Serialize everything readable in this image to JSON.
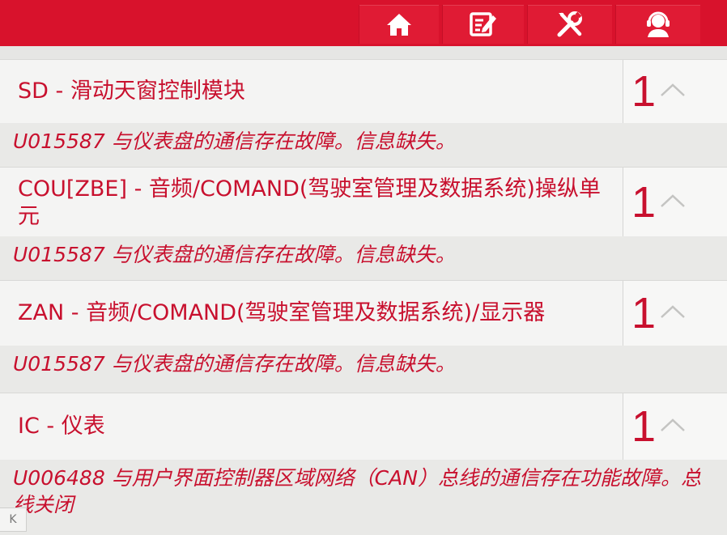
{
  "toolbar": {
    "buttons": [
      {
        "icon": "home-icon"
      },
      {
        "icon": "report-edit-icon"
      },
      {
        "icon": "tools-icon"
      },
      {
        "icon": "support-agent-icon"
      }
    ]
  },
  "modules": [
    {
      "name": "SD - 滑动天窗控制模块",
      "count": "1",
      "dtc": "U015587 与仪表盘的通信存在故障。信息缺失。"
    },
    {
      "name": "COU[ZBE] - 音频/COMAND(驾驶室管理及数据系统)操纵单元",
      "count": "1",
      "dtc": "U015587 与仪表盘的通信存在故障。信息缺失。"
    },
    {
      "name": "ZAN - 音频/COMAND(驾驶室管理及数据系统)/显示器",
      "count": "1",
      "dtc": "U015587 与仪表盘的通信存在故障。信息缺失。"
    },
    {
      "name": "IC - 仪表",
      "count": "1",
      "dtc": "U006488 与用户界面控制器区域网络（CAN）总线的通信存在功能故障。总线关闭"
    }
  ],
  "back_button": {
    "label": "K"
  },
  "colors": {
    "accent": "#c8102e",
    "topbar": "#d8122c"
  }
}
